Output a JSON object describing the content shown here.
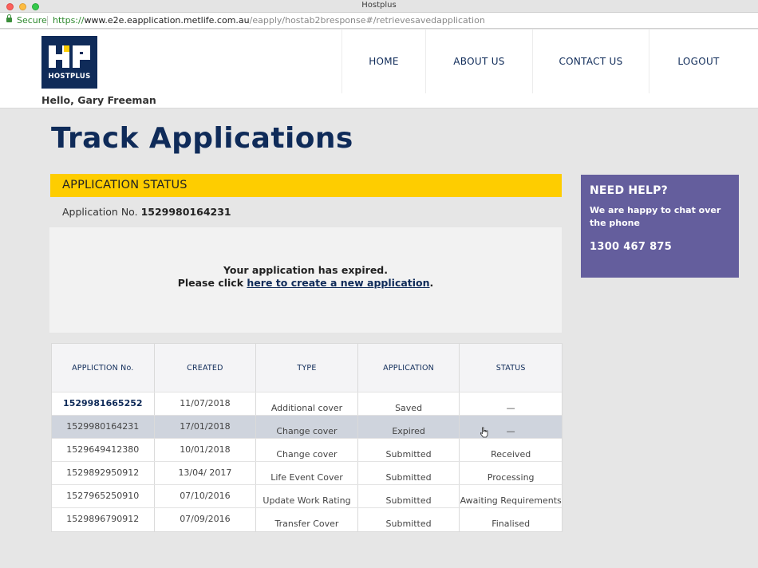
{
  "window": {
    "title": "Hostplus"
  },
  "address_bar": {
    "secure_label": "Secure",
    "url_scheme": "https://",
    "url_host": "www.e2e.eapplication.metlife.com.au",
    "url_path": "/eapply/hostab2bresponse#/retrievesavedapplication"
  },
  "header": {
    "logo_text": "HOSTPLUS",
    "greeting": "Hello, Gary Freeman",
    "nav": [
      {
        "label": "HOME"
      },
      {
        "label": "ABOUT US"
      },
      {
        "label": "CONTACT US"
      },
      {
        "label": "LOGOUT"
      }
    ]
  },
  "main": {
    "title": "Track Applications",
    "status_heading": "APPLICATION STATUS",
    "app_no_label": "Application No.",
    "app_no_value": "1529980164231",
    "expired_line1": "Your application has expired.",
    "expired_prefix": "Please click",
    "expired_link": "here to create a new application",
    "expired_suffix": "."
  },
  "help": {
    "heading": "NEED HELP?",
    "text": "We are happy to chat over the phone",
    "phone": "1300 467 875"
  },
  "table": {
    "columns": [
      "APPLICTION No.",
      "CREATED",
      "TYPE",
      "APPLICATION",
      "STATUS"
    ],
    "rows": [
      {
        "no": "1529981665252",
        "created": "11/07/2018",
        "type": "Additional cover",
        "application": "Saved",
        "status": "—"
      },
      {
        "no": "1529980164231",
        "created": "17/01/2018",
        "type": "Change cover",
        "application": "Expired",
        "status": "—"
      },
      {
        "no": "1529649412380",
        "created": "10/01/2018",
        "type": "Change cover",
        "application": "Submitted",
        "status": "Received"
      },
      {
        "no": "1529892950912",
        "created": "13/04/ 2017",
        "type": "Life Event Cover",
        "application": "Submitted",
        "status": "Processing"
      },
      {
        "no": "1527965250910",
        "created": "07/10/2016",
        "type": "Update Work Rating",
        "application": "Submitted",
        "status": "Awaiting Requirements"
      },
      {
        "no": "1529896790912",
        "created": "07/09/2016",
        "type": "Transfer Cover",
        "application": "Submitted",
        "status": "Finalised"
      }
    ]
  },
  "colors": {
    "navy": "#0f2b59",
    "yellow": "#fecd00",
    "purple": "#645e9d",
    "highlight_row": "#cfd4dd"
  },
  "icons": [
    "lock-icon",
    "hostplus-logo",
    "pointer-cursor-icon"
  ]
}
